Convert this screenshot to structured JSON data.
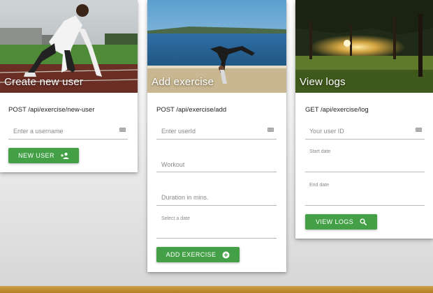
{
  "cards": {
    "new_user": {
      "title": "Create new user",
      "endpoint": "POST /api/exercise/new-user",
      "username_placeholder": "Enter a username",
      "button_label": "NEW USER",
      "button_icon": "person-add-icon"
    },
    "add_exercise": {
      "title": "Add exercise",
      "endpoint": "POST /api/exercise/add",
      "userid_placeholder": "Enter userId",
      "workout_placeholder": "Workout",
      "duration_placeholder": "Duration in mins.",
      "date_label": "Select a date",
      "button_label": "ADD EXERCISE",
      "button_icon": "add-circle-icon"
    },
    "view_logs": {
      "title": "View logs",
      "endpoint": "GET /api/exercise/log",
      "userid_placeholder": "Your user ID",
      "start_date_label": "Start date",
      "end_date_label": "End date",
      "button_label": "VIEW LOGS",
      "button_icon": "search-icon"
    }
  },
  "colors": {
    "button": "#43a047",
    "bottom_bar": "#b47d22"
  }
}
